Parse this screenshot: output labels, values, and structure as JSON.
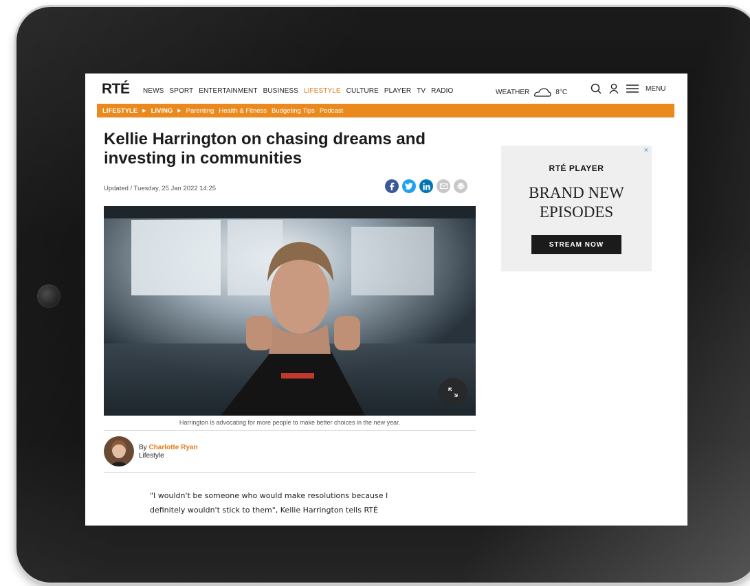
{
  "colors": {
    "accent": "#ea8a1e",
    "link_active": "#e47c1b",
    "facebook": "#3b5998",
    "twitter": "#1da1f2",
    "linkedin": "#0077b5",
    "email": "#c8c8c8"
  },
  "header": {
    "logo": "RTÉ",
    "nav": [
      "NEWS",
      "SPORT",
      "ENTERTAINMENT",
      "BUSINESS",
      "LIFESTYLE",
      "CULTURE",
      "PLAYER",
      "TV",
      "RADIO"
    ],
    "active_nav": "LIFESTYLE",
    "weather_label": "WEATHER",
    "weather_icon": "cloud-icon",
    "temperature": "8°C",
    "menu_label": "MENU"
  },
  "subnav": {
    "section": "LIFESTYLE",
    "subsection": "LIVING",
    "links": [
      "Parenting",
      "Health & Fitness",
      "Budgeting Tips",
      "Podcast"
    ]
  },
  "article": {
    "headline": "Kellie Harrington on chasing dreams and investing in communities",
    "dateline": "Updated / Tuesday, 25 Jan 2022 14:25",
    "share_icons": [
      "facebook-icon",
      "twitter-icon",
      "linkedin-icon",
      "email-icon",
      "print-icon"
    ],
    "caption": "Harrington is advocating for more people to make better choices in the new year.",
    "by_prefix": "By",
    "author": "Charlotte Ryan",
    "category": "Lifestyle",
    "body_line1": "\"I wouldn't be someone who would make resolutions because I",
    "body_line2": "definitely wouldn't stick to them\", Kellie Harrington tells RTÉ"
  },
  "ad": {
    "close": "×",
    "brand_prefix": "RTÉ",
    "brand_name": "PLAYER",
    "line1": "BRAND NEW",
    "line2": "EPISODES",
    "button": "STREAM NOW"
  }
}
